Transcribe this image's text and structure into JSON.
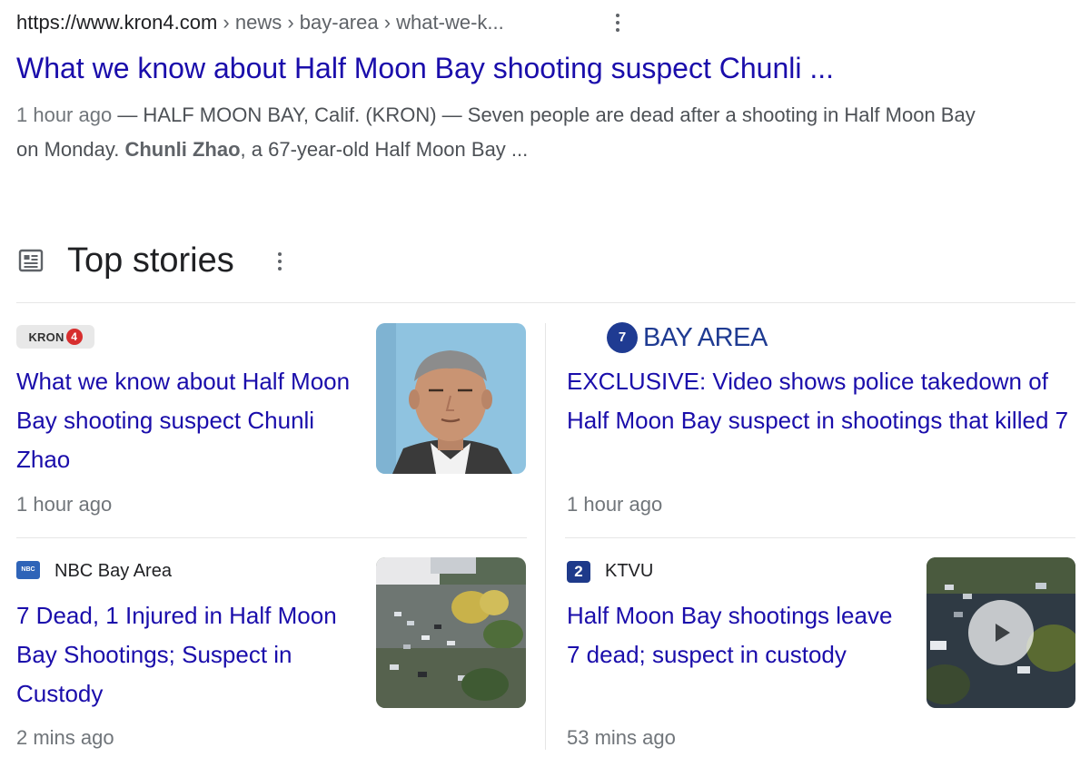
{
  "result": {
    "url_host": "https://www.kron4.com",
    "url_path": " › news › bay-area › what-we-k...",
    "title": "What we know about Half Moon Bay shooting suspect Chunli ...",
    "snippet_date": "1 hour ago",
    "snippet_before_bold": " — HALF MOON BAY, Calif. (KRON) — Seven people are dead after a shooting in Half Moon Bay on Monday. ",
    "snippet_bold": "Chunli Zhao",
    "snippet_after_bold": ", a 67-year-old Half Moon Bay ..."
  },
  "top_stories": {
    "heading": "Top stories",
    "icon": "newspaper-icon",
    "stories": [
      {
        "source": "KRON",
        "source_logo": "kron4-logo",
        "title": "What we know about Half Moon Bay shooting suspect Chunli Zhao",
        "time": "1 hour ago",
        "thumb": "portrait-photo"
      },
      {
        "source": "BAY AREA",
        "source_logo": "abc7-logo",
        "logo_mark": "7",
        "title": "EXCLUSIVE: Video shows police takedown of Half Moon Bay suspect in shootings that killed 7",
        "time": "1 hour ago"
      },
      {
        "source": "NBC Bay Area",
        "source_logo": "nbc-favicon",
        "title": "7 Dead, 1 Injured in Half Moon Bay Shootings; Suspect in Custody",
        "time": "2 mins ago",
        "thumb": "aerial-photo"
      },
      {
        "source": "KTVU",
        "source_logo": "ktvu-favicon",
        "logo_mark": "2",
        "title": "Half Moon Bay shootings leave 7 dead; suspect in custody",
        "time": "53 mins ago",
        "thumb": "aerial-video",
        "play_icon": "play-icon"
      }
    ]
  },
  "colors": {
    "link": "#1a0dab",
    "meta": "#70757a",
    "text": "#4d5156",
    "abc_blue": "#1f3b92",
    "kron_red": "#d72e2e"
  }
}
